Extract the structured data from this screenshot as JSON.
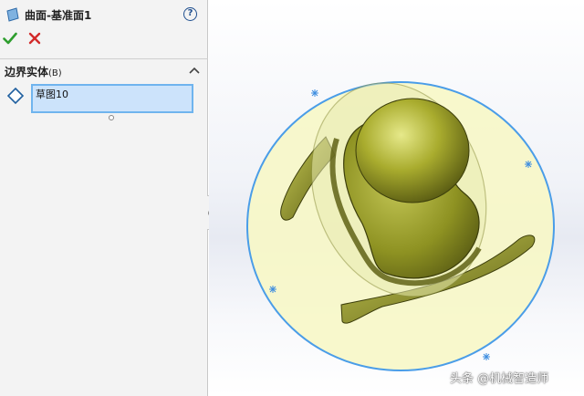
{
  "property_manager": {
    "title": "曲面-基准面1",
    "help_symbol": "?",
    "ok_icon": "check-icon",
    "cancel_icon": "close-icon",
    "section": {
      "label": "边界实体",
      "shortcut": "(B)",
      "icon": "boundary-diamond-icon",
      "selected_item": "草图10"
    }
  },
  "viewport": {
    "model_color": "#a4a82b",
    "planar_surface_color": "#f7f7c7",
    "sketch_boundary_color": "#4a9de8"
  },
  "watermark": "头条 @机械智造师"
}
